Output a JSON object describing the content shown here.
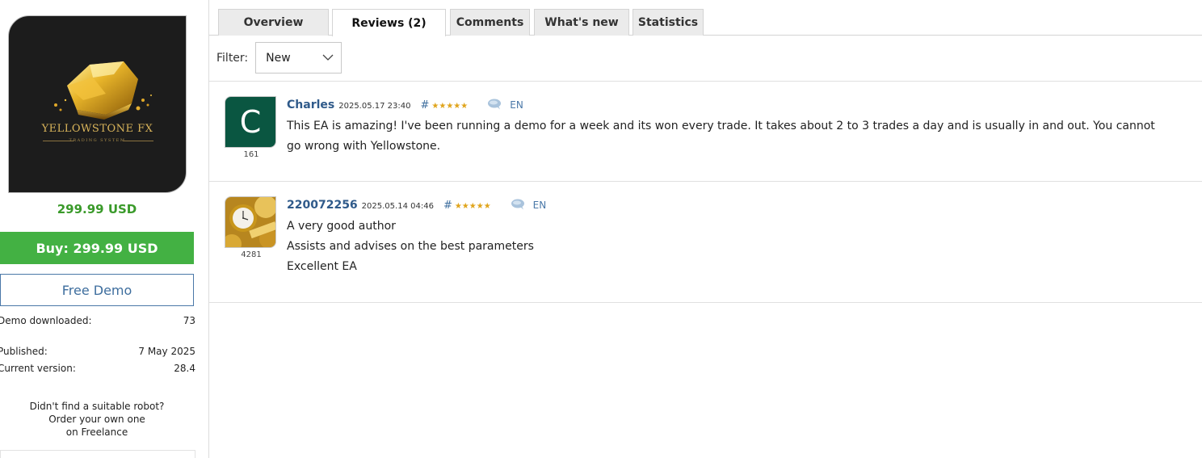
{
  "product": {
    "logo_title": "YELLOWSTONE FX",
    "logo_subtitle": "TRADING SYSTEM",
    "price": "299.99 USD",
    "buy_label": "Buy: 299.99 USD",
    "demo_label": "Free Demo"
  },
  "stats": {
    "demo_downloaded_label": "Demo downloaded:",
    "demo_downloaded_value": "73",
    "published_label": "Published:",
    "published_value": "7 May 2025",
    "version_label": "Current version:",
    "version_value": "28.4"
  },
  "freelance": {
    "line1": "Didn't find a suitable robot?",
    "line2": "Order your own one",
    "line3": "on Freelance"
  },
  "tabs": [
    {
      "label": "Overview"
    },
    {
      "label": "Reviews (2)"
    },
    {
      "label": "Comments"
    },
    {
      "label": "What's new"
    },
    {
      "label": "Statistics"
    }
  ],
  "filter": {
    "label": "Filter:",
    "selected": "New"
  },
  "reviews": [
    {
      "avatar_letter": "C",
      "avatar_count": "161",
      "author": "Charles",
      "date": "2025.05.17 23:40",
      "hash": "#",
      "stars": "★★★★★",
      "lang": "EN",
      "lines": [
        "This EA is amazing! I've been running a demo for a week and its won every trade. It takes about 2 to 3 trades a day and is usually in and out. You cannot go wrong with Yellowstone."
      ]
    },
    {
      "avatar_count": "4281",
      "author": "220072256",
      "date": "2025.05.14 04:46",
      "hash": "#",
      "stars": "★★★★★",
      "lang": "EN",
      "lines": [
        "A very good author",
        "Assists and advises on the best parameters",
        "Excellent EA"
      ]
    }
  ],
  "colors": {
    "price_green": "#3a9a2a",
    "buy_green": "#43b143",
    "link_blue": "#2f5a8a",
    "star_gold": "#e0a41b",
    "avatar_green": "#0a5641"
  }
}
